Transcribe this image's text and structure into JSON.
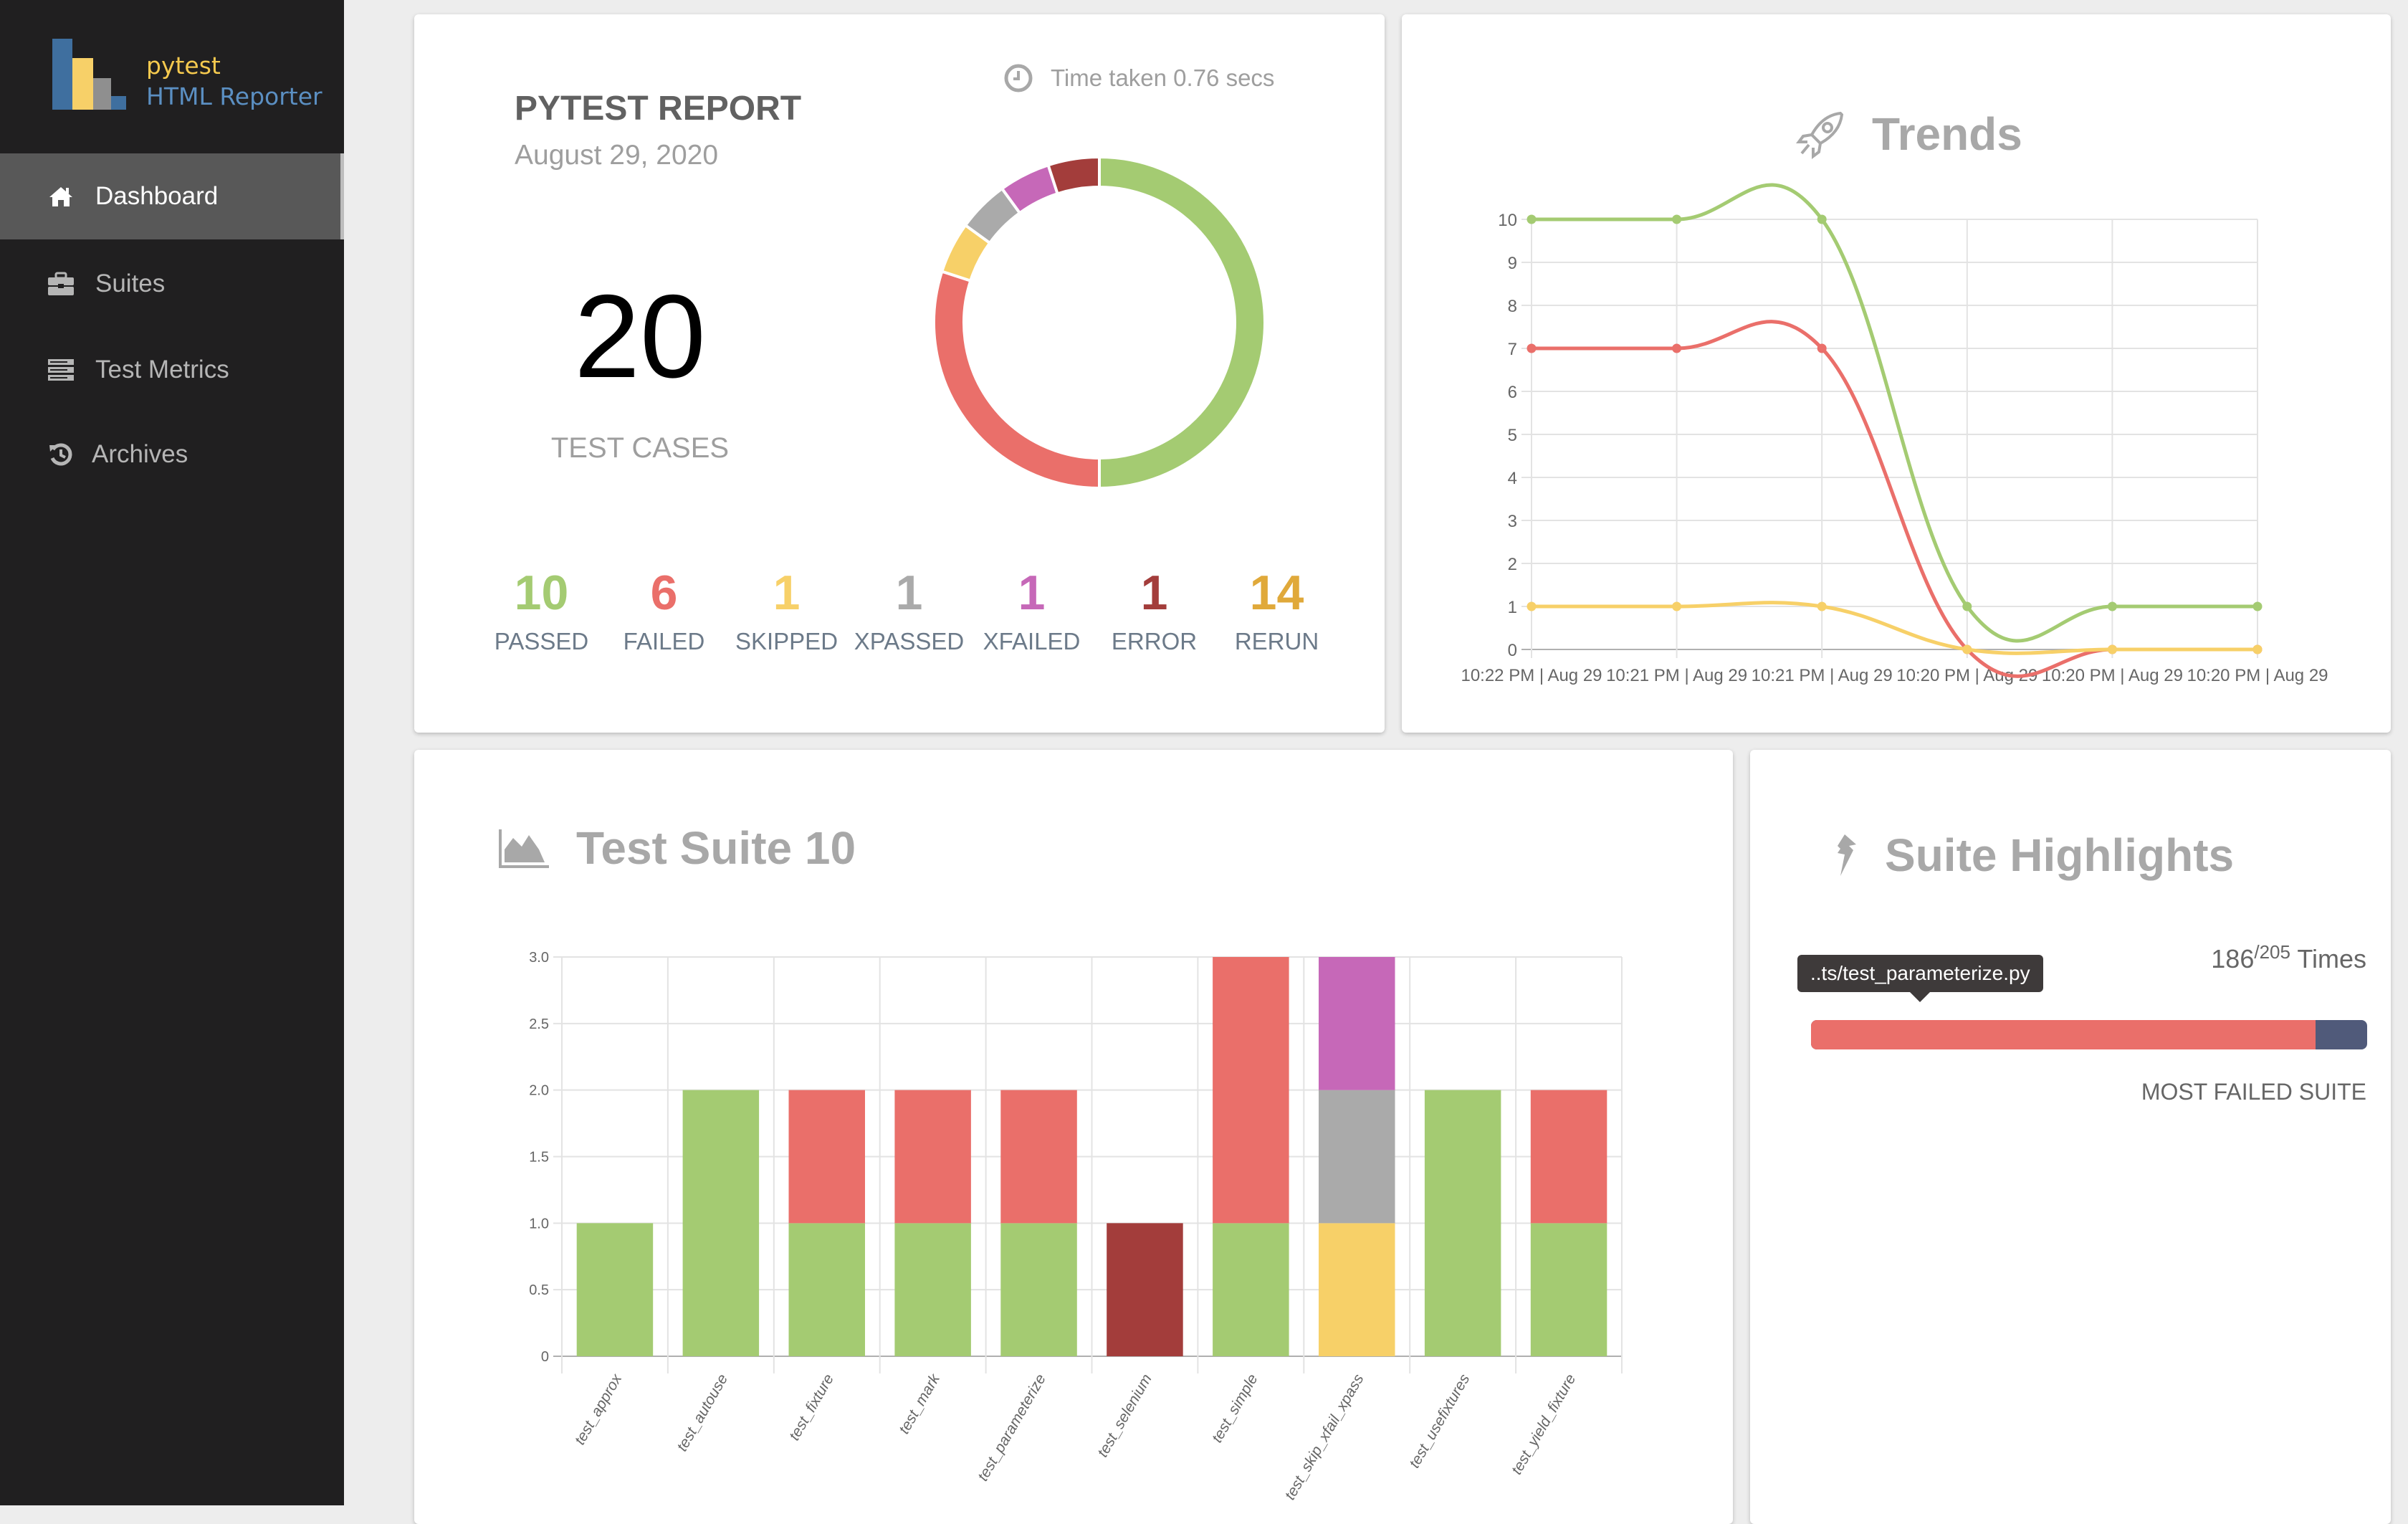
{
  "app": {
    "logo_line1": "pytest",
    "logo_line2": "HTML Reporter"
  },
  "sidebar": {
    "items": [
      {
        "label": "Dashboard",
        "icon": "home-icon",
        "active": true
      },
      {
        "label": "Suites",
        "icon": "briefcase-icon",
        "active": false
      },
      {
        "label": "Test Metrics",
        "icon": "server-icon",
        "active": false
      },
      {
        "label": "Archives",
        "icon": "history-icon",
        "active": false
      }
    ]
  },
  "report": {
    "title": "PYTEST REPORT",
    "date": "August 29, 2020",
    "time_taken": "Time taken 0.76 secs",
    "total": "20",
    "total_label": "TEST CASES",
    "pass_percent": "50%",
    "stats": [
      {
        "value": "10",
        "label": "PASSED",
        "color": "#a4cb72"
      },
      {
        "value": "6",
        "label": "FAILED",
        "color": "#ea6f6a"
      },
      {
        "value": "1",
        "label": "SKIPPED",
        "color": "#f7d068"
      },
      {
        "value": "1",
        "label": "XPASSED",
        "color": "#aaaaaa"
      },
      {
        "value": "1",
        "label": "XFAILED",
        "color": "#c668b8"
      },
      {
        "value": "1",
        "label": "ERROR",
        "color": "#a33d3b"
      },
      {
        "value": "14",
        "label": "RERUN",
        "color": "#e0a93a"
      }
    ]
  },
  "trends": {
    "title": "Trends"
  },
  "suite": {
    "title": "Test Suite 10"
  },
  "highlights": {
    "title": "Suite Highlights",
    "count": "186",
    "total": "/205",
    "unit": "Times",
    "tooltip": "..ts/test_parameterize.py",
    "fraction": 0.907,
    "label": "MOST FAILED SUITE"
  },
  "chart_data": [
    {
      "type": "pie",
      "title": "",
      "center_label": "50%",
      "labels": [
        "Passed",
        "Failed",
        "Skipped",
        "XPassed",
        "XFailed",
        "Error"
      ],
      "values": [
        10,
        6,
        1,
        1,
        1,
        1
      ],
      "colors": [
        "#a4cb72",
        "#ea6f6a",
        "#f7d068",
        "#aaaaaa",
        "#c668b8",
        "#a33d3b"
      ]
    },
    {
      "type": "line",
      "title": "Trends",
      "x": [
        "10:22 PM | Aug 29",
        "10:21 PM | Aug 29",
        "10:21 PM | Aug 29",
        "10:20 PM | Aug 29",
        "10:20 PM | Aug 29",
        "10:20 PM | Aug 29"
      ],
      "yticks": [
        0,
        1,
        2,
        3,
        4,
        5,
        6,
        7,
        8,
        9,
        10
      ],
      "ylim": [
        0,
        10
      ],
      "grid": true,
      "series": [
        {
          "name": "Passed",
          "values": [
            10,
            10,
            10,
            1,
            1,
            1
          ],
          "color": "#a4cb72"
        },
        {
          "name": "Failed",
          "values": [
            7,
            7,
            7,
            0,
            0,
            0
          ],
          "color": "#ea6f6a"
        },
        {
          "name": "Skipped",
          "values": [
            1,
            1,
            1,
            0,
            0,
            0
          ],
          "color": "#f7d068"
        }
      ]
    },
    {
      "type": "bar",
      "stacked": true,
      "title": "Test Suite 10",
      "categories": [
        "test_approx",
        "test_autouse",
        "test_fixture",
        "test_mark",
        "test_parameterize",
        "test_selenium",
        "test_simple",
        "test_skip_xfail_xpass",
        "test_usefixtures",
        "test_yield_fixture"
      ],
      "yticks": [
        "0",
        "0.5",
        "1.0",
        "1.5",
        "2.0",
        "2.5",
        "3.0"
      ],
      "ylim": [
        0,
        3
      ],
      "grid": true,
      "series": [
        {
          "name": "Passed",
          "color": "#a4cb72",
          "values": [
            1,
            2,
            1,
            1,
            1,
            0,
            1,
            0,
            2,
            1
          ]
        },
        {
          "name": "Failed",
          "color": "#ea6f6a",
          "values": [
            0,
            0,
            1,
            1,
            1,
            0,
            2,
            0,
            0,
            1
          ]
        },
        {
          "name": "Skipped",
          "color": "#f7d068",
          "values": [
            0,
            0,
            0,
            0,
            0,
            0,
            0,
            1,
            0,
            0
          ]
        },
        {
          "name": "XPassed",
          "color": "#aaaaaa",
          "values": [
            0,
            0,
            0,
            0,
            0,
            0,
            0,
            1,
            0,
            0
          ]
        },
        {
          "name": "XFailed",
          "color": "#c668b8",
          "values": [
            0,
            0,
            0,
            0,
            0,
            0,
            0,
            1,
            0,
            0
          ]
        },
        {
          "name": "Error",
          "color": "#a33d3b",
          "values": [
            0,
            0,
            0,
            0,
            0,
            1,
            0,
            0,
            0,
            0
          ]
        }
      ]
    }
  ]
}
